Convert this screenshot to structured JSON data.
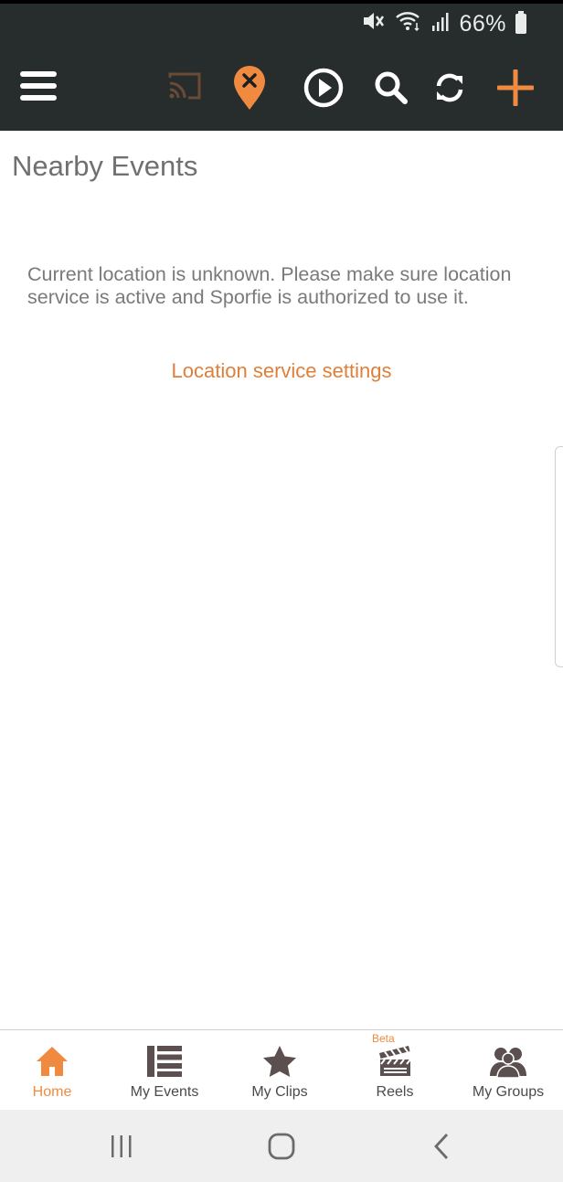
{
  "status_bar": {
    "battery_percent": "66%"
  },
  "colors": {
    "accent": "#f08a41",
    "topbar": "#262d2c",
    "icon_dark": "#5b4f4f"
  },
  "toolbar": {
    "icons": [
      "menu-icon",
      "cast-icon",
      "location-off-icon",
      "play-icon",
      "search-icon",
      "refresh-icon",
      "add-icon"
    ]
  },
  "page": {
    "title": "Nearby Events",
    "message": "Current location is unknown. Please make sure location service is active and Sporfie is authorized to use it.",
    "link_label": "Location service settings"
  },
  "tabs": [
    {
      "label": "Home",
      "icon": "home-icon",
      "active": true
    },
    {
      "label": "My Events",
      "icon": "list-icon",
      "active": false
    },
    {
      "label": "My Clips",
      "icon": "star-icon",
      "active": false
    },
    {
      "label": "Reels",
      "icon": "clapperboard-icon",
      "badge": "Beta",
      "active": false
    },
    {
      "label": "My Groups",
      "icon": "group-icon",
      "active": false
    }
  ],
  "system_nav": [
    "recents-icon",
    "home-circle-icon",
    "back-icon"
  ]
}
